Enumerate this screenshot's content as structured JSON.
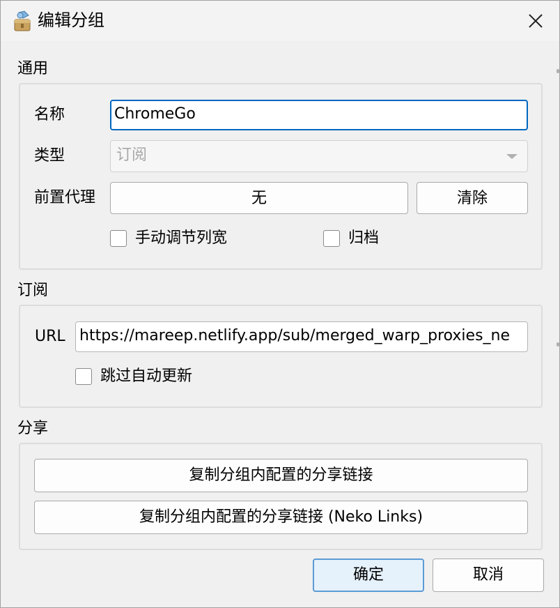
{
  "window": {
    "title": "编辑分组",
    "close_icon": "close-icon",
    "app_icon": "package-icon"
  },
  "general": {
    "section_title": "通用",
    "name_label": "名称",
    "name_value": "ChromeGo",
    "type_label": "类型",
    "type_value": "订阅",
    "front_proxy_label": "前置代理",
    "front_proxy_value": "无",
    "clear_button": "清除",
    "manual_column_width_label": "手动调节列宽",
    "manual_column_width_checked": false,
    "archive_label": "归档",
    "archive_checked": false
  },
  "subscription": {
    "section_title": "订阅",
    "url_label": "URL",
    "url_value": "https://mareep.netlify.app/sub/merged_warp_proxies_ne",
    "skip_auto_update_label": "跳过自动更新",
    "skip_auto_update_checked": false
  },
  "share": {
    "section_title": "分享",
    "copy_share_links_button": "复制分组内配置的分享链接",
    "copy_neko_links_button": "复制分组内配置的分享链接 (Neko Links)"
  },
  "footer": {
    "ok_button": "确定",
    "cancel_button": "取消"
  },
  "colors": {
    "focus_border": "#0067c0",
    "default_button_border": "#5b9bd5",
    "default_button_fill": "#e5f1fb"
  }
}
